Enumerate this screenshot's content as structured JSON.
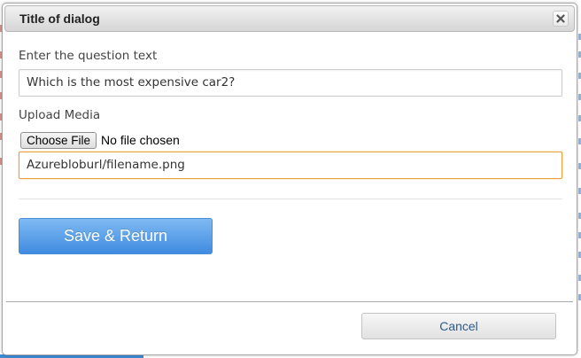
{
  "dialog": {
    "title": "Title of dialog",
    "close_icon": "close-icon"
  },
  "question": {
    "label": "Enter the question text",
    "value": "Which is the most expensive car2?"
  },
  "media": {
    "label": "Upload Media",
    "choose_file_label": "Choose File",
    "file_status": "No file chosen",
    "url_value": "Azurebloburl/filename.png"
  },
  "actions": {
    "save_label": "Save & Return",
    "cancel_label": "Cancel"
  },
  "colors": {
    "save_button": "#4a93e3",
    "focus_border": "#e6a03c",
    "cancel_text": "#2e5a8a"
  }
}
